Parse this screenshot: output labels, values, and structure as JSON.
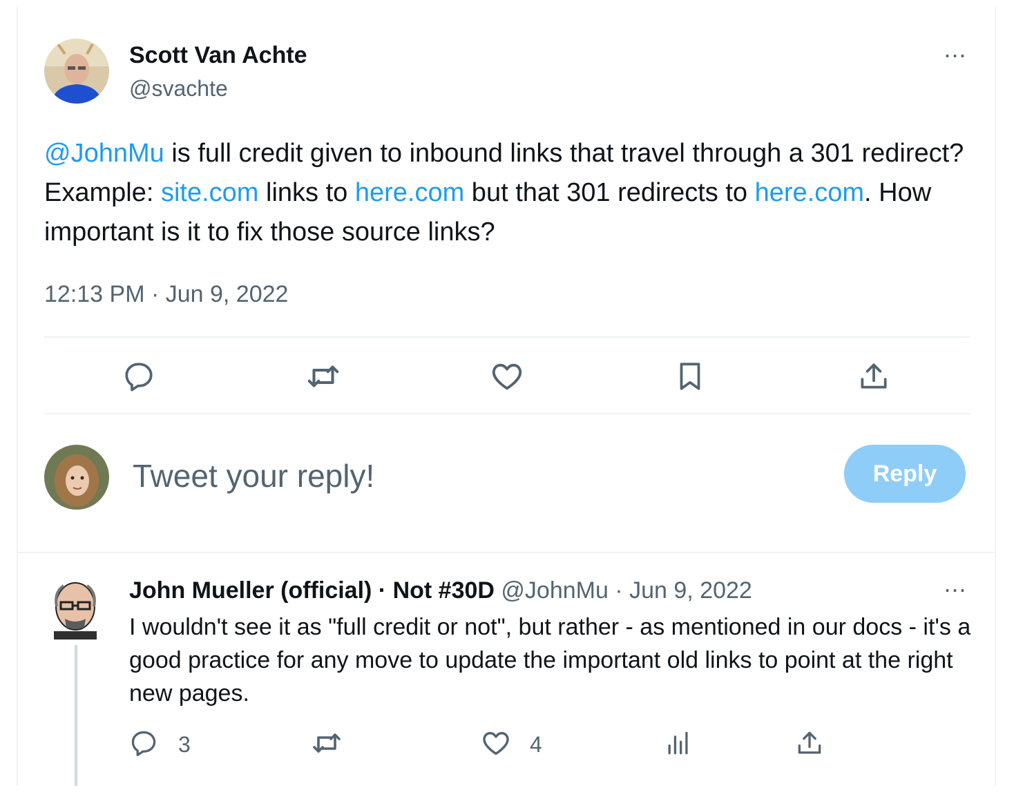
{
  "main_tweet": {
    "author_name": "Scott Van Achte",
    "author_handle": "@svachte",
    "text_parts": [
      {
        "text": "@JohnMu",
        "link": true
      },
      {
        "text": " is full credit given to inbound links that travel through a 301 redirect?   Example: ",
        "link": false
      },
      {
        "text": "site.com",
        "link": true
      },
      {
        "text": " links to ",
        "link": false
      },
      {
        "text": "here.com",
        "link": true
      },
      {
        "text": " but that 301 redirects to ",
        "link": false
      },
      {
        "text": "here.com",
        "link": true
      },
      {
        "text": ". How important is it to fix those source links?",
        "link": false
      }
    ],
    "timestamp": "12:13 PM · Jun 9, 2022",
    "actions": [
      "reply-icon",
      "retweet-icon",
      "like-icon",
      "bookmark-icon",
      "share-icon"
    ],
    "more_label": "···"
  },
  "composer": {
    "placeholder": "Tweet your reply!",
    "reply_button": "Reply"
  },
  "reply_tweet": {
    "author_name": "John Mueller (official) · Not #30D",
    "author_handle": "@JohnMu",
    "date": "· Jun 9, 2022",
    "text": "I wouldn't see it as \"full credit or not\", but rather - as mentioned in our docs - it's a good practice for any move to update the important old links to point at the right new pages.",
    "reply_count": "3",
    "like_count": "4",
    "more_label": "···"
  },
  "colors": {
    "link": "#1d9bf0",
    "muted": "#536471",
    "reply_button_bg": "#8ecdf8",
    "divider": "#eff3f4"
  }
}
